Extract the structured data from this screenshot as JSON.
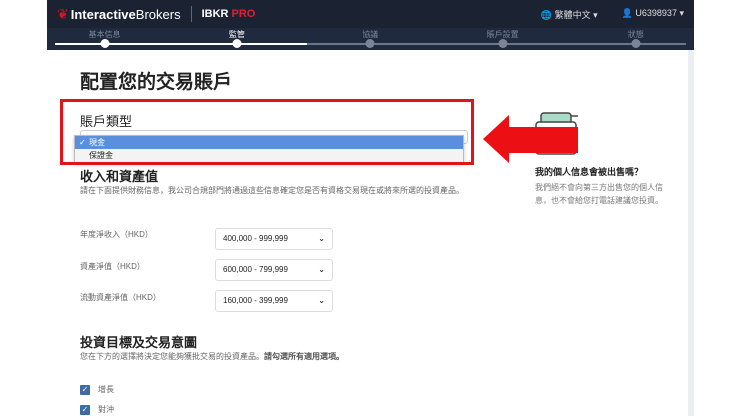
{
  "header": {
    "brand_bold": "Interactive",
    "brand_light": "Brokers",
    "product": "IBKR",
    "product_accent": "PRO",
    "language": "繁體中文",
    "user": "U6398937"
  },
  "steps": [
    {
      "label": "基本信息",
      "state": "done"
    },
    {
      "label": "監管",
      "state": "active"
    },
    {
      "label": "協議",
      "state": "pending"
    },
    {
      "label": "賬戶設置",
      "state": "pending"
    },
    {
      "label": "狀態",
      "state": "pending"
    }
  ],
  "progress_percent": 40,
  "page_title": "配置您的交易賬戶",
  "account_type": {
    "label": "賬戶類型",
    "options": [
      "現金",
      "保證金"
    ],
    "selected": "現金"
  },
  "income": {
    "title": "收入和資產值",
    "description": "請在下面提供財務信息，我公司合規部門將通過這些信息確定您是否有資格交易現在或將來所選的投資產品。",
    "fields": [
      {
        "label": "年度淨收入（HKD）",
        "value": "400,000 - 999,999"
      },
      {
        "label": "資產淨值（HKD）",
        "value": "600,000 - 799,999"
      },
      {
        "label": "流動資產淨值（HKD）",
        "value": "160,000 - 399,999"
      }
    ]
  },
  "objectives": {
    "title": "投資目標及交易意圖",
    "description": "您在下方的選擇將決定您能夠獲批交易的投資產品。",
    "description_bold": "請勾選所有適用選項。",
    "options": [
      {
        "label": "增長",
        "checked": true
      },
      {
        "label": "對沖",
        "checked": true
      }
    ]
  },
  "privacy_card": {
    "title": "我的個人信息會被出售嗎？",
    "text": "我們絕不會向第三方出售您的個人信息，也不會給您打電話建議您投資。"
  },
  "colors": {
    "header": "#1b2333",
    "highlight": "#e1141b",
    "selected_option": "#5a8fe0",
    "checkbox": "#3e6ba6"
  }
}
